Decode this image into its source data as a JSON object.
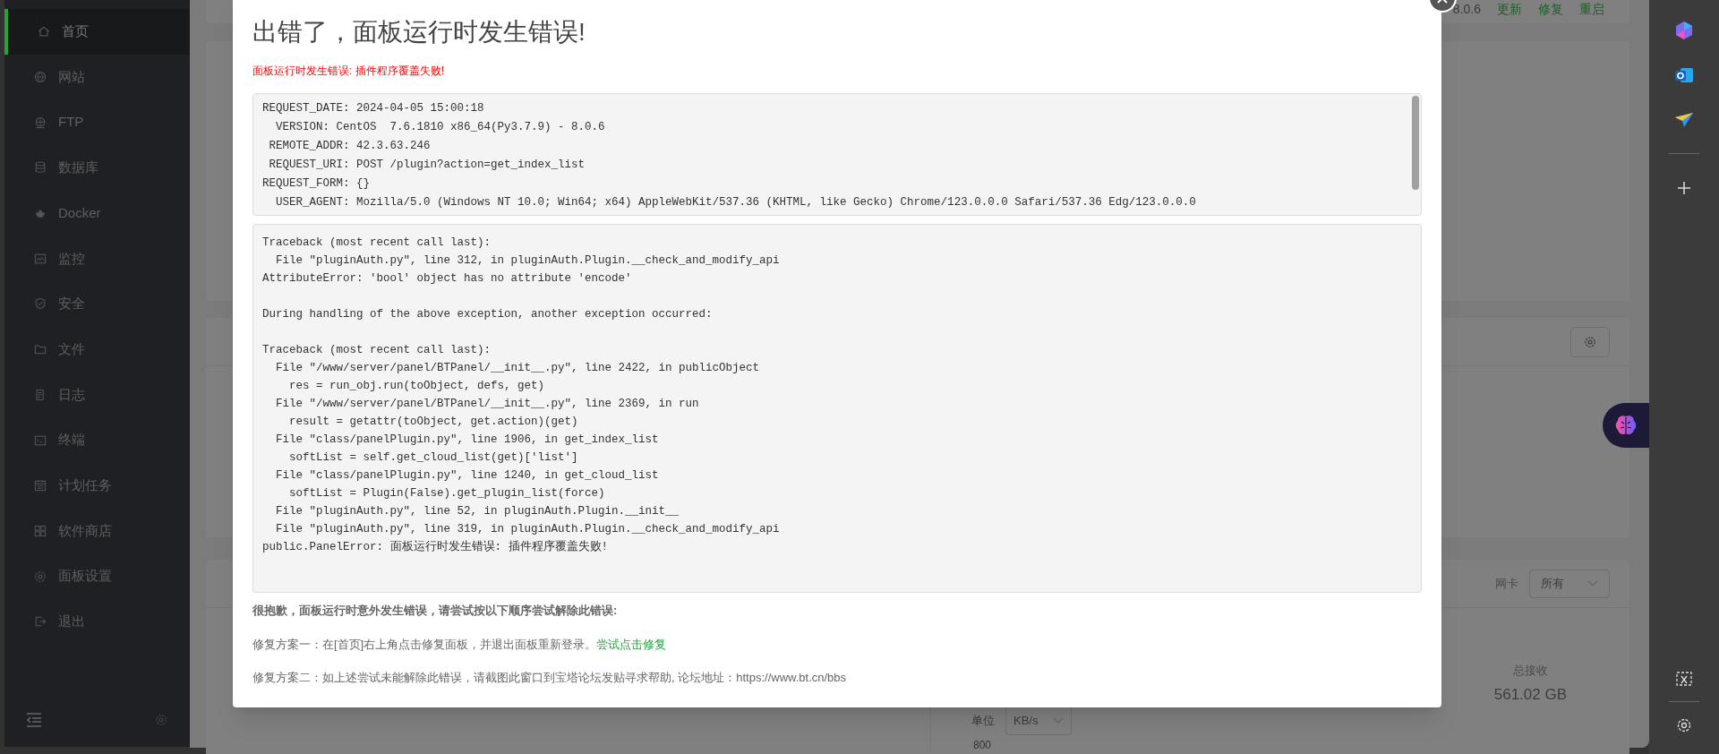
{
  "sidebar": {
    "items": [
      {
        "label": "首页",
        "selected": true
      },
      {
        "label": "网站",
        "selected": false
      },
      {
        "label": "FTP",
        "selected": false
      },
      {
        "label": "数据库",
        "selected": false
      },
      {
        "label": "Docker",
        "selected": false
      },
      {
        "label": "监控",
        "selected": false
      },
      {
        "label": "安全",
        "selected": false
      },
      {
        "label": "文件",
        "selected": false
      },
      {
        "label": "日志",
        "selected": false
      },
      {
        "label": "终端",
        "selected": false
      },
      {
        "label": "计划任务",
        "selected": false
      },
      {
        "label": "软件商店",
        "selected": false
      },
      {
        "label": "面板设置",
        "selected": false
      },
      {
        "label": "退出",
        "selected": false
      }
    ]
  },
  "background": {
    "version": "8.0.6",
    "version_actions": [
      "更新",
      "修复",
      "重启"
    ],
    "nic_label": "网卡",
    "nic_select": "所有",
    "total_received_label": "总接收",
    "total_received_value": "561.02 GB",
    "unit_label": "单位",
    "unit_select": "KB/s",
    "chart_axis_value": "800"
  },
  "dialog": {
    "title": "出错了，面板运行时发生错误!",
    "error_summary": "面板运行时发生错误: 插件程序覆盖失败!",
    "request_info": [
      "REQUEST_DATE: 2024-04-05 15:00:18",
      "  VERSION: CentOS  7.6.1810 x86_64(Py3.7.9) - 8.0.6",
      " REMOTE_ADDR: 42.3.63.246",
      " REQUEST_URI: POST /plugin?action=get_index_list",
      "REQUEST_FORM: {}",
      "  USER_AGENT: Mozilla/5.0 (Windows NT 10.0; Win64; x64) AppleWebKit/537.36 (KHTML, like Gecko) Chrome/123.0.0.0 Safari/537.36 Edg/123.0.0.0"
    ],
    "traceback": [
      [
        "Traceback (most recent call last):",
        "  File \"pluginAuth.py\", line 312, in pluginAuth.Plugin.__check_and_modify_api",
        "AttributeError: 'bool' object has no attribute 'encode'"
      ],
      [
        "During handling of the above exception, another exception occurred:"
      ],
      [
        "Traceback (most recent call last):",
        "  File \"/www/server/panel/BTPanel/__init__.py\", line 2422, in publicObject",
        "    res = run_obj.run(toObject, defs, get)",
        "  File \"/www/server/panel/BTPanel/__init__.py\", line 2369, in run",
        "    result = getattr(toObject, get.action)(get)",
        "  File \"class/panelPlugin.py\", line 1906, in get_index_list",
        "    softList = self.get_cloud_list(get)['list']",
        "  File \"class/panelPlugin.py\", line 1240, in get_cloud_list",
        "    softList = Plugin(False).get_plugin_list(force)",
        "  File \"pluginAuth.py\", line 52, in pluginAuth.Plugin.__init__",
        "  File \"pluginAuth.py\", line 319, in pluginAuth.Plugin.__check_and_modify_api",
        "public.PanelError: 面板运行时发生错误: 插件程序覆盖失败!"
      ]
    ],
    "advice_heading": "很抱歉，面板运行时意外发生错误，请尝试按以下顺序尝试解除此错误:",
    "fix_steps": [
      {
        "text": "修复方案一：在[首页]右上角点击修复面板，并退出面板重新登录。",
        "link": "尝试点击修复"
      },
      {
        "text": "修复方案二：如上述尝试未能解除此错误，请截图此窗口到宝塔论坛发贴寻求帮助, 论坛地址：https://www.bt.cn/bbs"
      }
    ]
  }
}
